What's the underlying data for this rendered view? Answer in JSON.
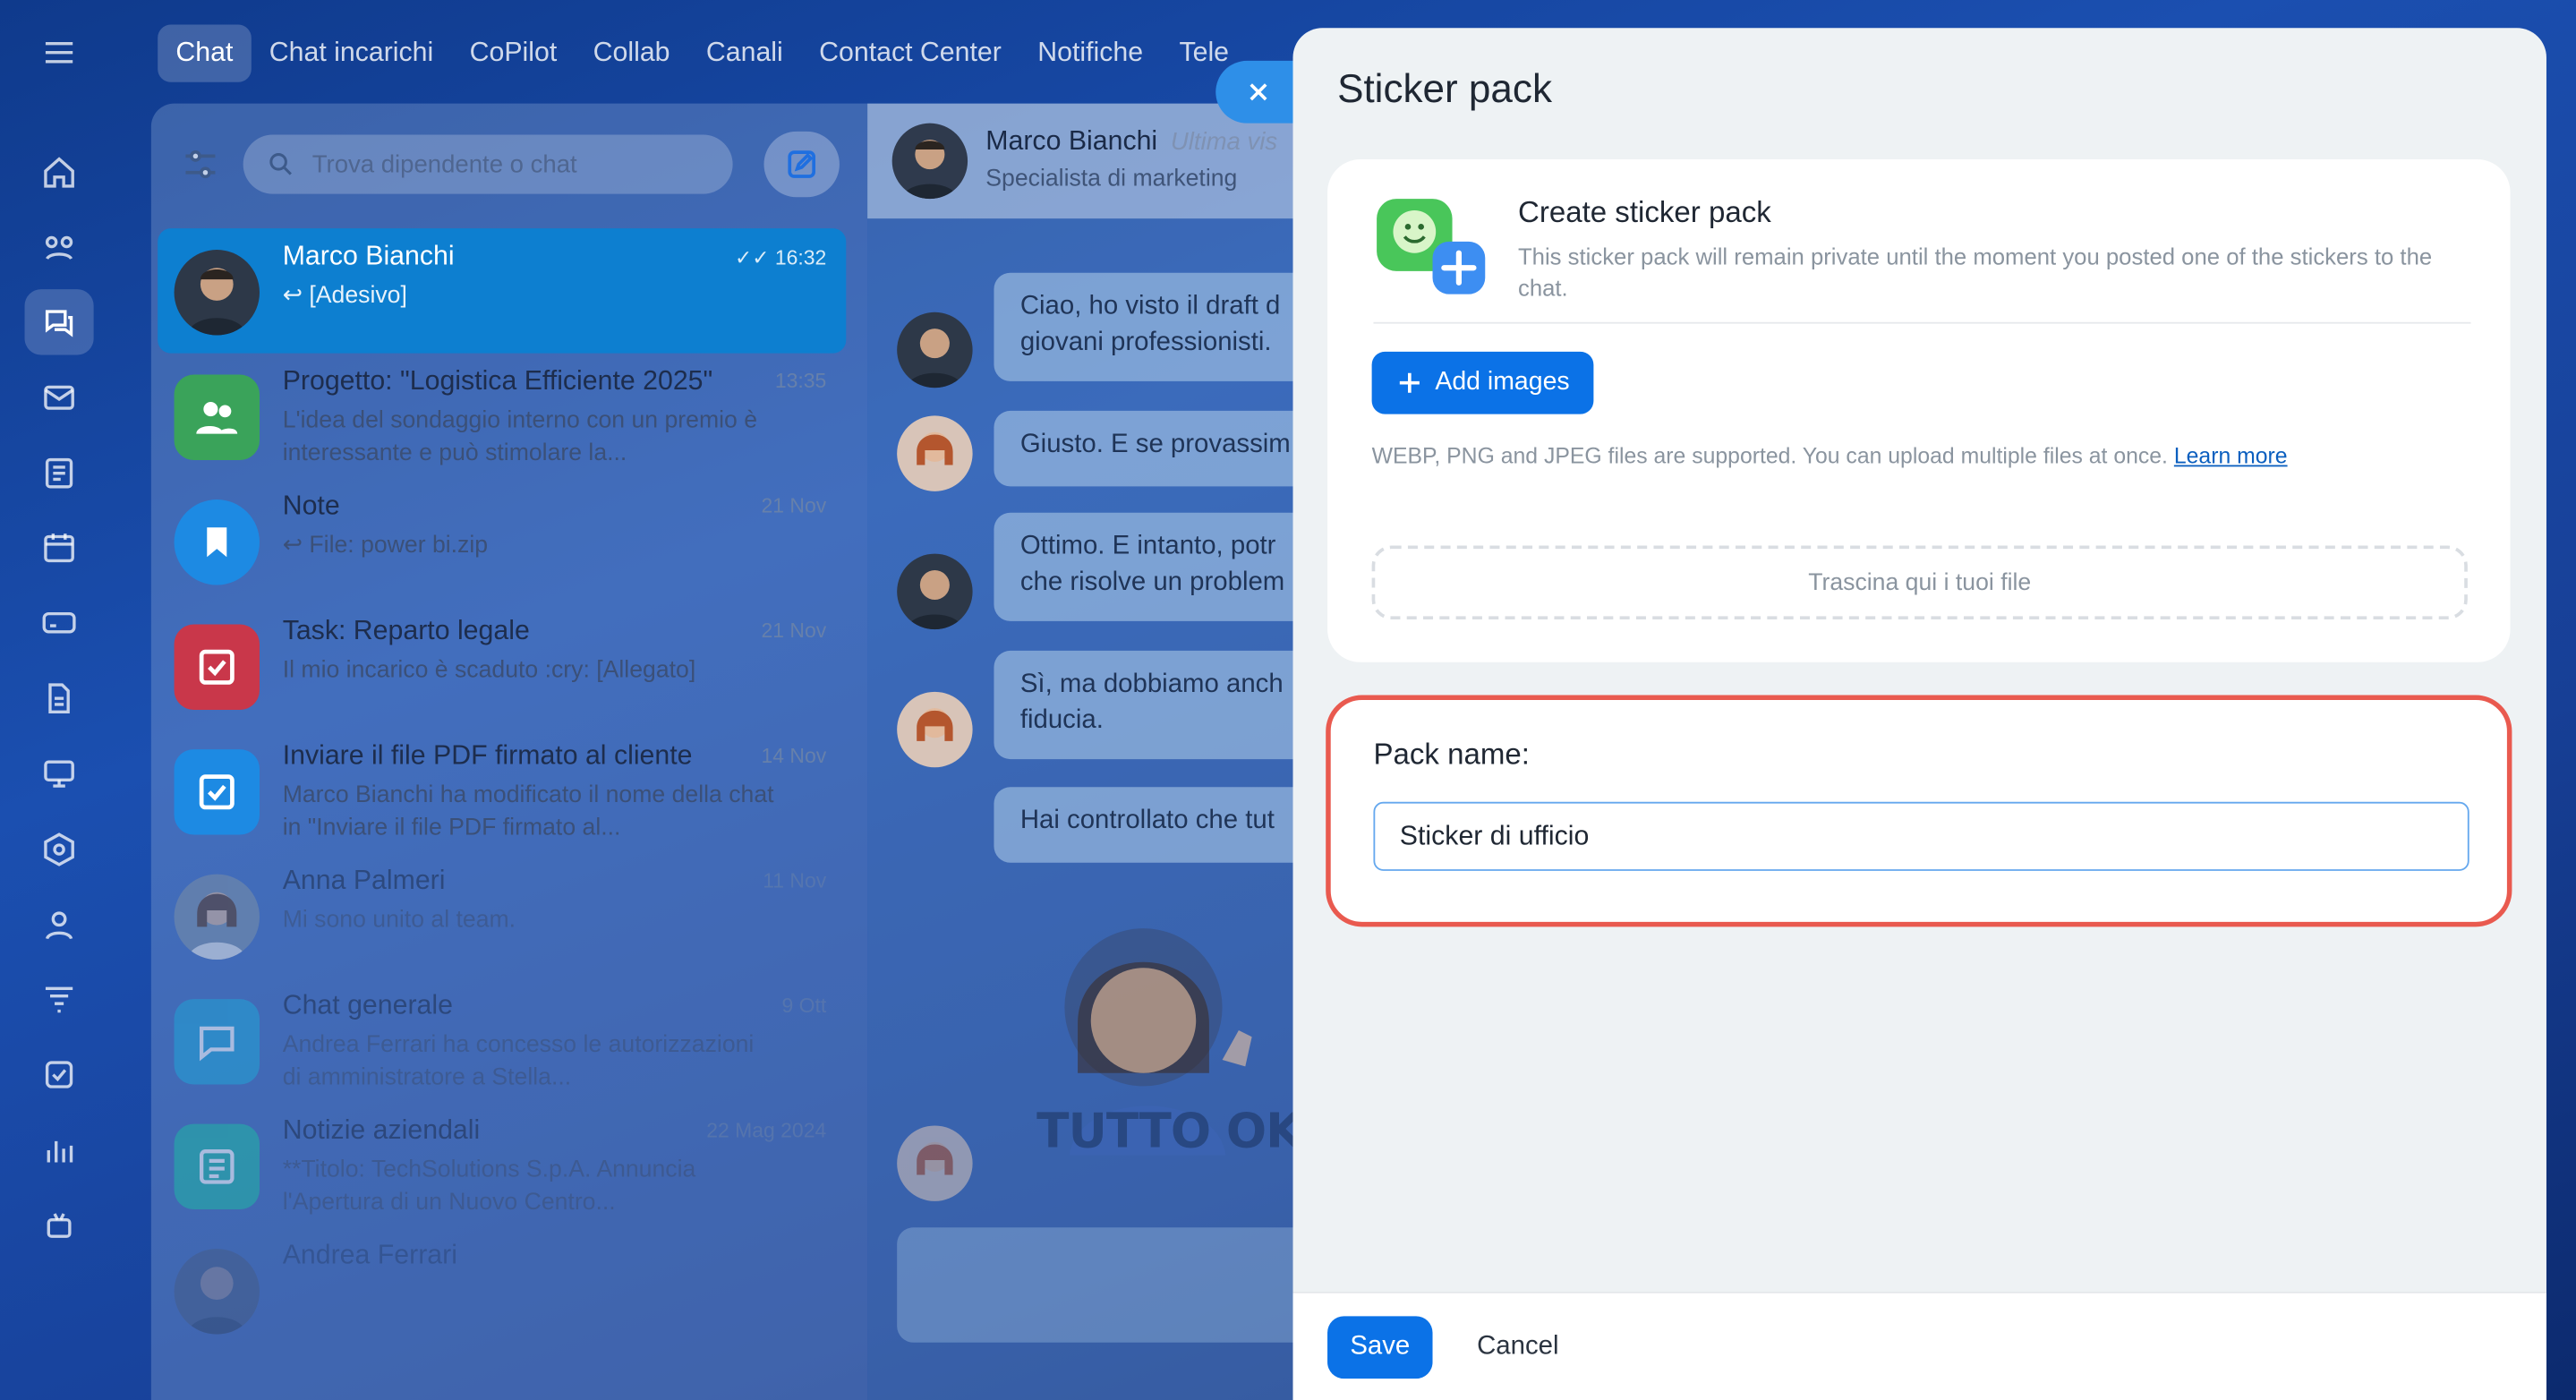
{
  "top_tabs": [
    "Chat",
    "Chat incarichi",
    "CoPilot",
    "Collab",
    "Canali",
    "Contact Center",
    "Notifiche",
    "Tele"
  ],
  "search": {
    "placeholder": "Trova dipendente o chat"
  },
  "chats": [
    {
      "name": "Marco Bianchi",
      "time": "16:32",
      "preview": "↩ [Adesivo]"
    },
    {
      "name": "Progetto: \"Logistica Efficiente 2025\"",
      "time": "13:35",
      "preview": "L'idea del sondaggio interno con un premio è interessante e può stimolare la..."
    },
    {
      "name": "Note",
      "time": "21 Nov",
      "preview": "↩ File: power bi.zip"
    },
    {
      "name": "Task: Reparto legale",
      "time": "21 Nov",
      "preview": "Il mio incarico è scaduto :cry: [Allegato]"
    },
    {
      "name": "Inviare il file PDF firmato al cliente",
      "time": "14 Nov",
      "preview": "Marco Bianchi ha modificato il nome della chat in \"Inviare il file PDF firmato al..."
    },
    {
      "name": "Anna Palmeri",
      "time": "11 Nov",
      "preview": "Mi sono unito al team."
    },
    {
      "name": "Chat generale",
      "time": "9 Ott",
      "preview": "Andrea Ferrari ha concesso le autorizzazioni di amministratore a Stella..."
    },
    {
      "name": "Notizie aziendali",
      "time": "22 Mag 2024",
      "preview": "**Titolo: TechSolutions S.p.A. Annuncia l'Apertura di un Nuovo Centro..."
    },
    {
      "name": "Andrea Ferrari",
      "time": "",
      "preview": ""
    }
  ],
  "conversation": {
    "name": "Marco Bianchi",
    "status": "Ultima vis",
    "role": "Specialista di marketing",
    "messages": [
      "Ciao, ho visto il draft d\ngiovani professionisti.",
      "Giusto. E se provassim",
      "Ottimo. E intanto, potr\nche risolve un problem",
      "Sì, ma dobbiamo anch\nfiducia.",
      "Hai controllato che tut"
    ],
    "sticker_text": "TUTTO OK"
  },
  "panel": {
    "title": "Sticker pack",
    "create_title": "Create sticker pack",
    "create_desc": "This sticker pack will remain private until the moment you posted one of the stickers to the chat.",
    "add_images": "Add images",
    "formats_text": "WEBP, PNG and JPEG files are supported. You can upload multiple files at once.",
    "learn_more": "Learn more",
    "dropzone": "Trascina qui i tuoi file",
    "pack_name_label": "Pack name:",
    "pack_name_value": "Sticker di ufficio",
    "save": "Save",
    "cancel": "Cancel"
  },
  "colors": {
    "accent": "#0b72e7",
    "highlight_border": "#e95a4f",
    "active_chat": "#0d7fd0"
  }
}
